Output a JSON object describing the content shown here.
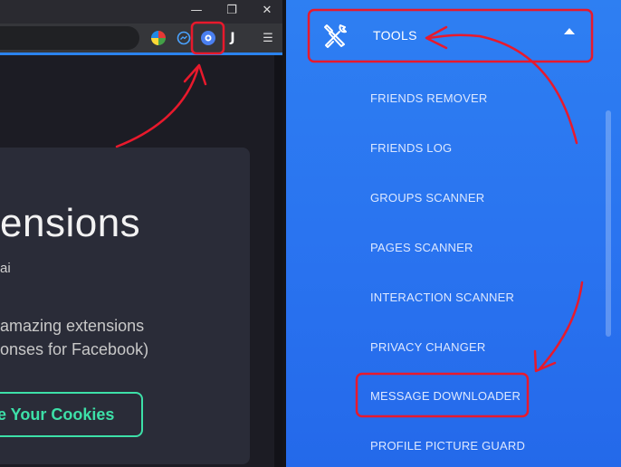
{
  "browser": {
    "window_controls": {
      "minimize": "—",
      "restore": "❐",
      "close": "✕"
    },
    "extensions": [
      "colorful-extension-icon",
      "messenger-icon",
      "extension-active-icon",
      "j-icon"
    ],
    "page": {
      "heading": "ensions",
      "byline": "ai",
      "description_line1": " amazing extensions",
      "description_line2": "onses for Facebook)",
      "cookie_button": "e Your Cookies"
    }
  },
  "menu": {
    "section_label": "TOOLS",
    "items": [
      "FRIENDS REMOVER",
      "FRIENDS LOG",
      "GROUPS SCANNER",
      "PAGES SCANNER",
      "INTERACTION SCANNER",
      "PRIVACY CHANGER",
      "MESSAGE DOWNLOADER",
      "PROFILE PICTURE GUARD"
    ]
  },
  "colors": {
    "menu_gradient_top": "#2e7ff2",
    "menu_gradient_bottom": "#2469ea",
    "annotation_red": "#e8192c",
    "cookie_button_accent": "#3de0a8"
  }
}
